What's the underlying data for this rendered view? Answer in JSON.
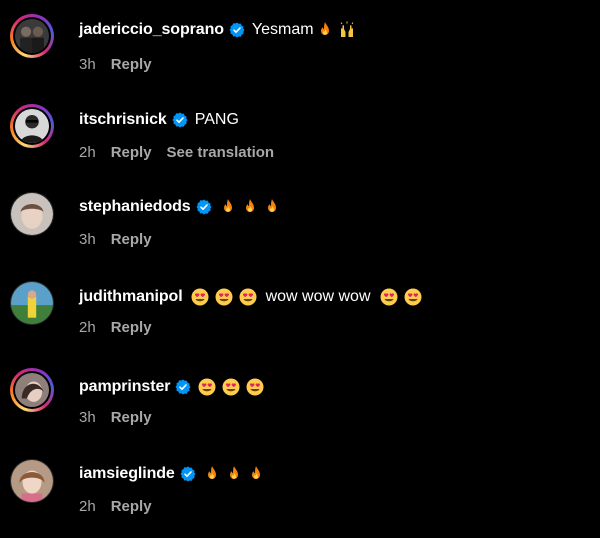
{
  "comments": [
    {
      "username": "jadericcio_soprano",
      "verified": true,
      "text_before": "Yesmam",
      "emojis": [
        "fire-emoji",
        "raised-hands-emoji"
      ],
      "time": "3h",
      "reply_label": "Reply",
      "avatar_ring": true
    },
    {
      "username": "itschrisnick",
      "verified": true,
      "text_before": "PANG",
      "emojis": [],
      "time": "2h",
      "reply_label": "Reply",
      "see_translation_label": "See translation",
      "avatar_ring": true
    },
    {
      "username": "stephaniedods",
      "verified": true,
      "text_before": "",
      "emojis": [
        "fire-emoji",
        "fire-emoji",
        "fire-emoji"
      ],
      "time": "3h",
      "reply_label": "Reply",
      "avatar_ring": false
    },
    {
      "username": "judithmanipol",
      "verified": false,
      "text_middle": "wow wow wow",
      "emojis_before": [
        "heart-eyes-emoji",
        "heart-eyes-emoji",
        "heart-eyes-emoji"
      ],
      "emojis_after": [
        "heart-eyes-emoji",
        "heart-eyes-emoji"
      ],
      "time": "2h",
      "reply_label": "Reply",
      "avatar_ring": false
    },
    {
      "username": "pamprinster",
      "verified": true,
      "text_before": "",
      "emojis": [
        "heart-eyes-emoji",
        "heart-eyes-emoji",
        "heart-eyes-emoji"
      ],
      "time": "3h",
      "reply_label": "Reply",
      "avatar_ring": true
    },
    {
      "username": "iamsieglinde",
      "verified": true,
      "text_before": "",
      "emojis": [
        "fire-emoji",
        "fire-emoji",
        "fire-emoji"
      ],
      "time": "2h",
      "reply_label": "Reply",
      "avatar_ring": false
    }
  ],
  "colors": {
    "background": "#000000",
    "primary_text": "#ffffff",
    "secondary_text": "#a8a8a8",
    "verified_badge": "#0095f6"
  }
}
